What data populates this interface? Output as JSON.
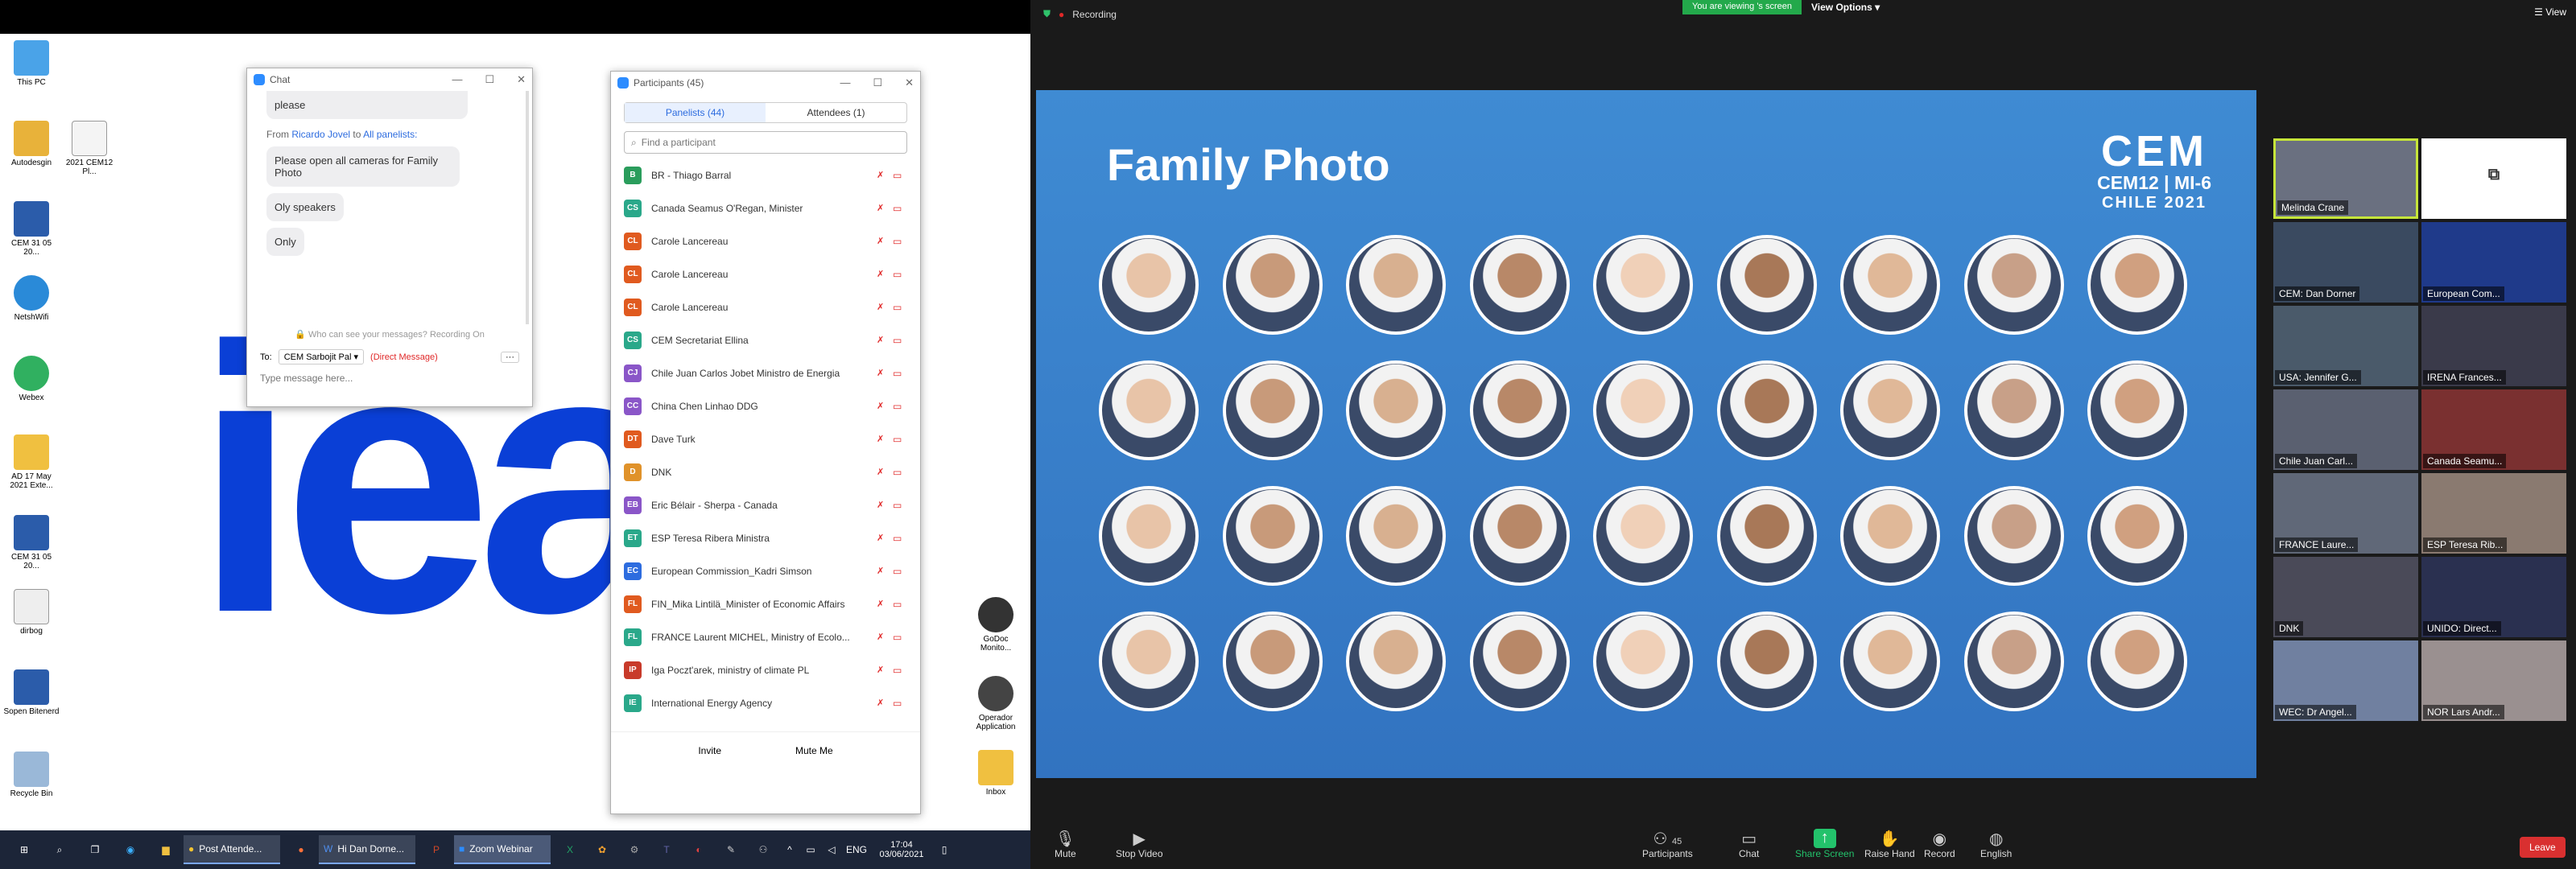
{
  "desktop": {
    "logo_text": "iea",
    "icons": [
      {
        "label": "This PC"
      },
      {
        "label": "Autodesgin"
      },
      {
        "label": "2021 CEM12 Pl..."
      },
      {
        "label": "CEM 31 05 20..."
      },
      {
        "label": "NetshWifi"
      },
      {
        "label": "Webex"
      },
      {
        "label": "AD 17 May 2021 Exte..."
      },
      {
        "label": "CEM 31 05 20..."
      },
      {
        "label": "dirbog"
      },
      {
        "label": "Sopen Bitenerd"
      },
      {
        "label": "Recycle Bin"
      },
      {
        "label": "GoDoc Monito..."
      },
      {
        "label": "Operador Application"
      },
      {
        "label": "Inbox"
      }
    ]
  },
  "chat": {
    "title": "Chat",
    "msg_top": "please",
    "from_prefix": "From",
    "from_name": "Ricardo Jovel",
    "from_to": "to",
    "from_target": "All panelists:",
    "messages": [
      "Please open all cameras for Family Photo",
      "Oly speakers",
      "Only"
    ],
    "privacy": "Who can see your messages? Recording On",
    "to_label": "To:",
    "to_value": "CEM Sarbojit Pal",
    "direct": "(Direct Message)",
    "input_placeholder": "Type message here..."
  },
  "participants": {
    "title": "Participants (45)",
    "tab_panelists": "Panelists (44)",
    "tab_attendees": "Attendees (1)",
    "search_placeholder": "Find a participant",
    "rows": [
      {
        "i": "B",
        "n": "BR - Thiago Barral",
        "c": "#2a9d5c"
      },
      {
        "i": "CS",
        "n": "Canada Seamus O'Regan, Minister",
        "c": "#2aa88a"
      },
      {
        "i": "CL",
        "n": "Carole Lancereau",
        "c": "#e05a1f"
      },
      {
        "i": "CL",
        "n": "Carole Lancereau",
        "c": "#e05a1f"
      },
      {
        "i": "CL",
        "n": "Carole Lancereau",
        "c": "#e05a1f"
      },
      {
        "i": "CS",
        "n": "CEM Secretariat Ellina",
        "c": "#2aa88a"
      },
      {
        "i": "CJ",
        "n": "Chile Juan Carlos Jobet Ministro de Energia",
        "c": "#8a56c8"
      },
      {
        "i": "CC",
        "n": "China Chen Linhao DDG",
        "c": "#8a56c8"
      },
      {
        "i": "DT",
        "n": "Dave Turk",
        "c": "#e05a1f"
      },
      {
        "i": "D",
        "n": "DNK",
        "c": "#e0922a"
      },
      {
        "i": "EB",
        "n": "Eric Bélair - Sherpa - Canada",
        "c": "#8a56c8"
      },
      {
        "i": "ET",
        "n": "ESP Teresa Ribera Ministra",
        "c": "#2aa88a"
      },
      {
        "i": "EC",
        "n": "European Commission_Kadri Simson",
        "c": "#2d6cdf"
      },
      {
        "i": "FL",
        "n": "FIN_Mika Lintilä_Minister of Economic Affairs",
        "c": "#e05a1f"
      },
      {
        "i": "FL",
        "n": "FRANCE Laurent MICHEL, Ministry of Ecolo...",
        "c": "#2aa88a"
      },
      {
        "i": "IP",
        "n": "Iga Poczt'arek, ministry of climate PL",
        "c": "#c83a2a"
      },
      {
        "i": "IE",
        "n": "International Energy Agency",
        "c": "#2aa88a"
      }
    ],
    "invite": "Invite",
    "mute_me": "Mute Me"
  },
  "taskbar": {
    "apps": [
      "Post Attende...",
      "Hi Dan Dorne...",
      "Zoom Webinar"
    ],
    "lang": "ENG",
    "time": "17:04",
    "date": "03/06/2021"
  },
  "zoom": {
    "recording": "Recording",
    "viewing": "You are viewing 's screen",
    "view_options": "View Options",
    "view": "View",
    "slide_title": "Family Photo",
    "brand_mark": "CEM",
    "brand_line": "CEM12 | MI-6",
    "brand_country": "CHILE 2021",
    "tiles": [
      "Melinda Crane",
      "",
      "CEM: Dan Dorner",
      "European Com...",
      "USA: Jennifer G...",
      "IRENA Frances...",
      "Chile Juan Carl...",
      "Canada Seamu...",
      "FRANCE Laure...",
      "ESP Teresa Rib...",
      "DNK",
      "UNIDO: Direct...",
      "WEC: Dr Angel...",
      "NOR Lars Andr..."
    ],
    "controls": {
      "mute": "Mute",
      "stop_video": "Stop Video",
      "participants": "Participants",
      "participants_count": "45",
      "chat": "Chat",
      "share": "Share Screen",
      "raise": "Raise Hand",
      "record": "Record",
      "english": "English",
      "leave": "Leave"
    }
  }
}
